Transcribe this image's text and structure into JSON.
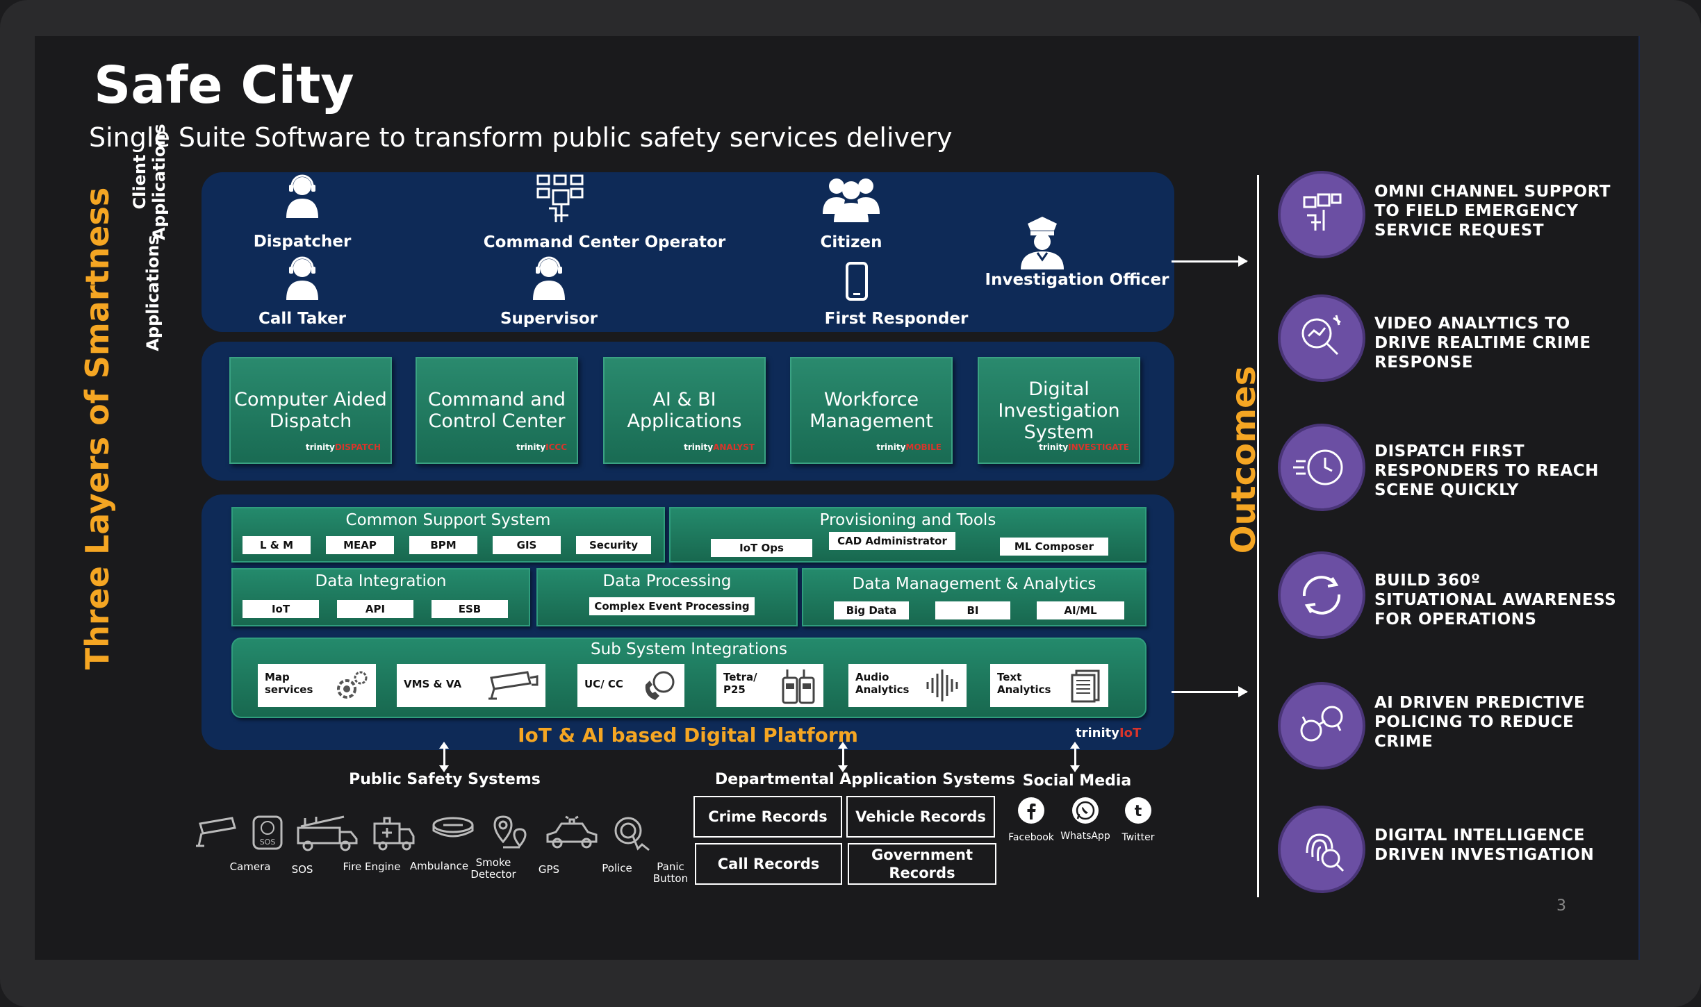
{
  "header": {
    "title": "Safe City",
    "subtitle": "Single Suite Software to transform public safety services delivery"
  },
  "side_labels": {
    "three_layers": "Three Layers of Smartness",
    "client_applications_line1": "Client",
    "client_applications_line2": "Applications",
    "applications": "Applications",
    "outcomes": "Outcomes"
  },
  "client_roles": {
    "dispatcher": "Dispatcher",
    "call_taker": "Call Taker",
    "command_center_operator": "Command Center Operator",
    "supervisor": "Supervisor",
    "citizen": "Citizen",
    "first_responder": "First Responder",
    "investigation_officer": "Investigation Officer"
  },
  "applications": [
    {
      "line1": "Computer Aided",
      "line2": "Dispatch",
      "line3": "",
      "brand": "trinity",
      "brand_suffix": "DISPATCH"
    },
    {
      "line1": "Command and",
      "line2": "Control Center",
      "line3": "",
      "brand": "trinity",
      "brand_suffix": "ICCC"
    },
    {
      "line1": "AI & BI",
      "line2": "Applications",
      "line3": "",
      "brand": "trinity",
      "brand_suffix": "ANALYST"
    },
    {
      "line1": "Workforce",
      "line2": "Management",
      "line3": "",
      "brand": "trinity",
      "brand_suffix": "MOBILE"
    },
    {
      "line1": "Digital",
      "line2": "Investigation",
      "line3": "System",
      "brand": "trinity",
      "brand_suffix": "INVESTIGATE"
    }
  ],
  "platform": {
    "common_support": {
      "title": "Common Support System",
      "items": [
        "L & M",
        "MEAP",
        "BPM",
        "GIS",
        "Security"
      ]
    },
    "provisioning": {
      "title": "Provisioning and Tools",
      "items": [
        "IoT Ops",
        "CAD Administrator",
        "ML Composer"
      ]
    },
    "data_integration": {
      "title": "Data Integration",
      "items": [
        "IoT",
        "API",
        "ESB"
      ]
    },
    "data_processing": {
      "title": "Data Processing",
      "items": [
        "Complex Event Processing"
      ]
    },
    "data_management": {
      "title": "Data Management & Analytics",
      "items": [
        "Big Data",
        "BI",
        "AI/ML"
      ]
    },
    "subsystem": {
      "title": "Sub System Integrations",
      "items": [
        {
          "line1": "Map",
          "line2": "services"
        },
        {
          "line1": "VMS & VA",
          "line2": ""
        },
        {
          "line1": "UC/ CC",
          "line2": ""
        },
        {
          "line1": "Tetra/",
          "line2": "P25"
        },
        {
          "line1": "Audio",
          "line2": "Analytics"
        },
        {
          "line1": "Text",
          "line2": "Analytics"
        }
      ]
    },
    "footer": "IoT & AI based Digital Platform",
    "brand": "trinity",
    "brand_suffix": "IoT"
  },
  "public_safety": {
    "title": "Public Safety Systems",
    "items": [
      {
        "line1": "Camera",
        "line2": ""
      },
      {
        "line1": "SOS",
        "line2": ""
      },
      {
        "line1": "Fire Engine",
        "line2": ""
      },
      {
        "line1": "Ambulance",
        "line2": ""
      },
      {
        "line1": "Smoke",
        "line2": "Detector"
      },
      {
        "line1": "GPS",
        "line2": ""
      },
      {
        "line1": "Police",
        "line2": ""
      },
      {
        "line1": "Panic",
        "line2": "Button"
      }
    ]
  },
  "departmental": {
    "title": "Departmental Application Systems",
    "items": [
      {
        "line1": "Crime Records",
        "line2": ""
      },
      {
        "line1": "Vehicle Records",
        "line2": ""
      },
      {
        "line1": "Call Records",
        "line2": ""
      },
      {
        "line1": "Government",
        "line2": "Records"
      }
    ]
  },
  "social_media": {
    "title": "Social Media",
    "items": [
      "Facebook",
      "WhatsApp",
      "Twitter"
    ]
  },
  "outcomes": [
    {
      "line1": "OMNI CHANNEL SUPPORT",
      "line2": "TO FIELD EMERGENCY",
      "line3": "SERVICE REQUEST",
      "icon": "forms-icon"
    },
    {
      "line1": "VIDEO ANALYTICS TO",
      "line2": "DRIVE REALTIME CRIME",
      "line3": "RESPONSE",
      "icon": "magnifier-analytics-icon"
    },
    {
      "line1": "DISPATCH FIRST",
      "line2": "RESPONDERS TO REACH",
      "line3": "SCENE QUICKLY",
      "icon": "fast-clock-icon"
    },
    {
      "line1": "BUILD 360º",
      "line2": "SITUATIONAL AWARENESS",
      "line3": "FOR OPERATIONS",
      "icon": "cycle-arrows-icon"
    },
    {
      "line1": "AI DRIVEN PREDICTIVE",
      "line2": "POLICING TO REDUCE",
      "line3": "CRIME",
      "icon": "handcuffs-icon"
    },
    {
      "line1": "DIGITAL INTELLIGENCE",
      "line2": "DRIVEN INVESTIGATION",
      "line3": "",
      "icon": "fingerprint-icon"
    }
  ],
  "page_number": "3",
  "colors": {
    "accent": "#f5a623",
    "panel": "#0e2a57",
    "green": "#1f7a5e",
    "purple": "#6b4fa3"
  }
}
